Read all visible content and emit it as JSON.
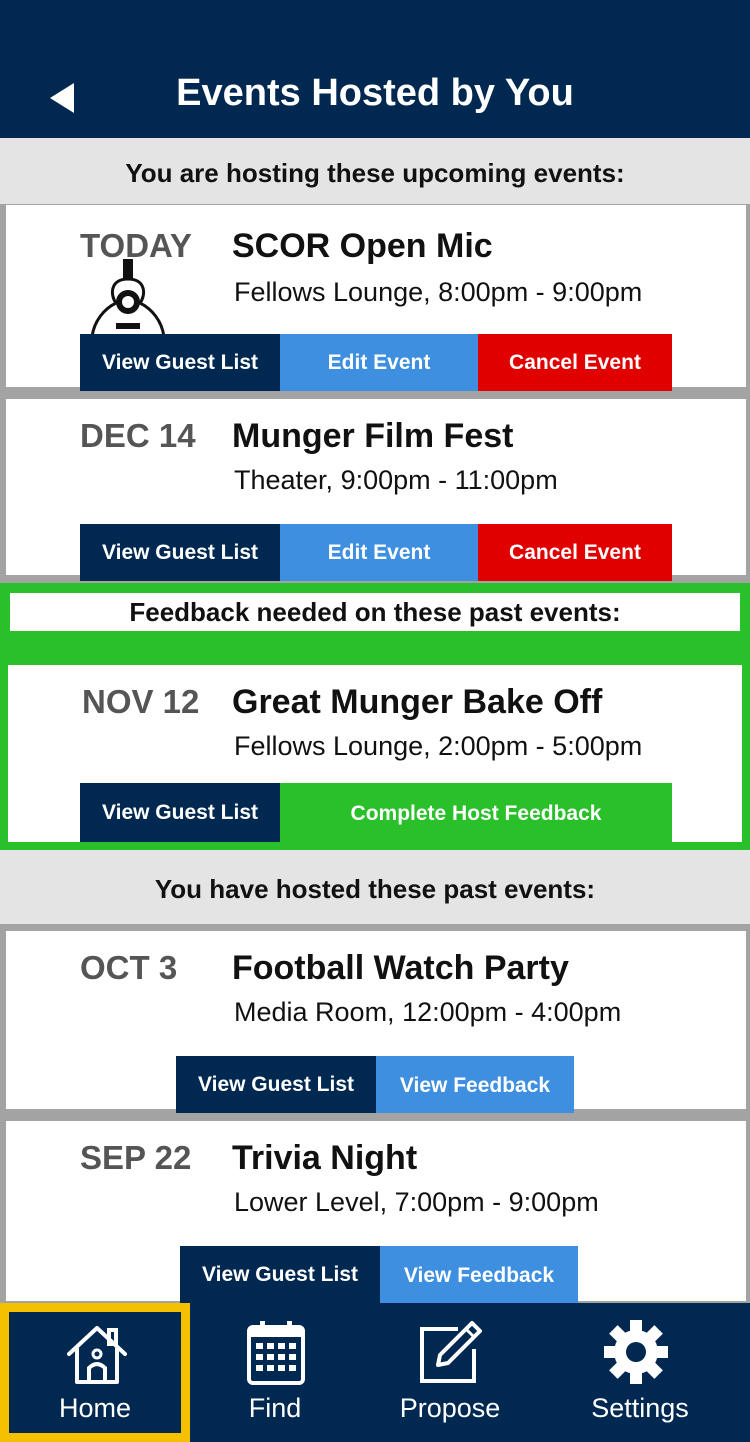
{
  "header": {
    "title": "Events Hosted by You"
  },
  "sections": {
    "upcoming": "You are hosting these upcoming events:",
    "feedback_needed": "Feedback needed on these past events:",
    "past": "You have hosted these past events:"
  },
  "upcoming": [
    {
      "date": "TODAY",
      "title": "SCOR Open Mic",
      "detail": "Fellows Lounge, 8:00pm - 9:00pm",
      "icon": "guitar-icon",
      "buttons": {
        "guests": "View Guest List",
        "edit": "Edit Event",
        "cancel": "Cancel Event"
      }
    },
    {
      "date": "DEC 14",
      "title": "Munger Film Fest",
      "detail": "Theater, 9:00pm - 11:00pm",
      "buttons": {
        "guests": "View Guest List",
        "edit": "Edit Event",
        "cancel": "Cancel Event"
      }
    }
  ],
  "feedback": [
    {
      "date": "NOV 12",
      "title": "Great Munger Bake Off",
      "detail": "Fellows Lounge, 2:00pm - 5:00pm",
      "buttons": {
        "guests": "View Guest List",
        "feedback": "Complete Host Feedback"
      }
    }
  ],
  "past": [
    {
      "date": "OCT 3",
      "title": "Football Watch Party",
      "detail": "Media Room, 12:00pm - 4:00pm",
      "buttons": {
        "guests": "View Guest List",
        "feedback": "View Feedback"
      }
    },
    {
      "date": "SEP 22",
      "title": "Trivia Night",
      "detail": "Lower Level, 7:00pm - 9:00pm",
      "buttons": {
        "guests": "View Guest List",
        "feedback": "View Feedback"
      }
    }
  ],
  "tabs": [
    {
      "label": "Home",
      "icon": "home-icon",
      "selected": true
    },
    {
      "label": "Find",
      "icon": "calendar-icon"
    },
    {
      "label": "Propose",
      "icon": "pencil-square-icon"
    },
    {
      "label": "Settings",
      "icon": "gear-icon"
    }
  ],
  "colors": {
    "navy": "#002850",
    "blue": "#3e8fe0",
    "red": "#e00000",
    "green": "#2ac02a",
    "highlight": "#f5c000"
  }
}
